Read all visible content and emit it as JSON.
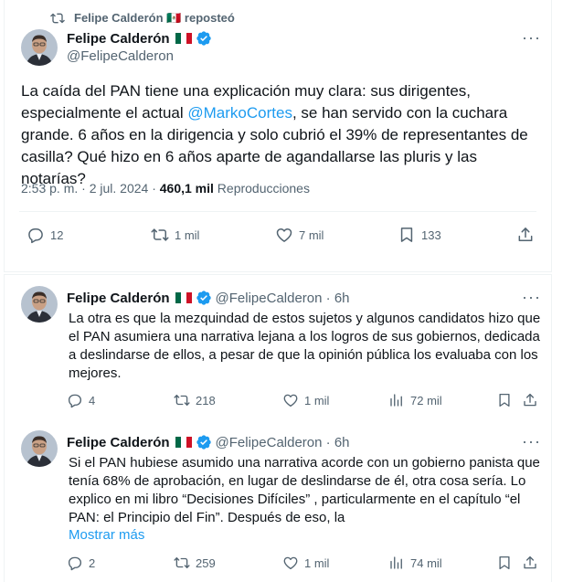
{
  "repost": {
    "text": "Felipe Calderón 🇲🇽 reposteó"
  },
  "main_tweet": {
    "name": "Felipe Calderón",
    "handle": "@FelipeCalderon",
    "text_before": "La caída del PAN tiene una explicación muy clara: sus dirigentes, especialmente el actual ",
    "mention": "@MarkoCortes",
    "text_after": ", se han servido con la cuchara grande. 6 años en la dirigencia y solo cubrió el 39% de representantes de casilla? Qué hizo en 6 años aparte de agandallarse las pluris y las notarías?",
    "time": "2:53 p. m. · 2 jul. 2024 · ",
    "views": "460,1 mil",
    "views_label": " Reproducciones",
    "replies": "12",
    "reposts": "1 mil",
    "likes": "7 mil",
    "bookmarks": "133"
  },
  "replies": [
    {
      "name": "Felipe Calderón",
      "handle": "@FelipeCalderon · 6h",
      "text": "La otra es que la mezquindad de estos sujetos y algunos candidatos hizo que el PAN asumiera una narrativa lejana a los logros de sus gobiernos, dedicada a deslindarse de ellos, a pesar de que la opinión pública los evaluaba con los mejores.",
      "replies": "4",
      "reposts": "218",
      "likes": "1 mil",
      "views": "72 mil"
    },
    {
      "name": "Felipe Calderón",
      "handle": "@FelipeCalderon · 6h",
      "text": "Si el PAN hubiese asumido una narrativa acorde con un gobierno panista que tenía 68% de aprobación, en lugar de deslindarse de él, otra cosa sería. Lo explico en mi libro “Decisiones Difíciles” , particularmente en el capítulo “el PAN: el Principio del Fin”. Después de eso, la",
      "show_more": "Mostrar más",
      "replies": "2",
      "reposts": "259",
      "likes": "1 mil",
      "views": "74 mil"
    }
  ],
  "more_icon": "···",
  "colors": {
    "accent": "#1d9bf0",
    "muted": "#536471",
    "text": "#0f1419",
    "border": "#eff3f4"
  },
  "icons": [
    "repost-icon",
    "verified-badge-icon",
    "more-icon",
    "reply-icon",
    "like-icon",
    "views-icon",
    "bookmark-icon",
    "share-icon",
    "mexico-flag-icon"
  ]
}
